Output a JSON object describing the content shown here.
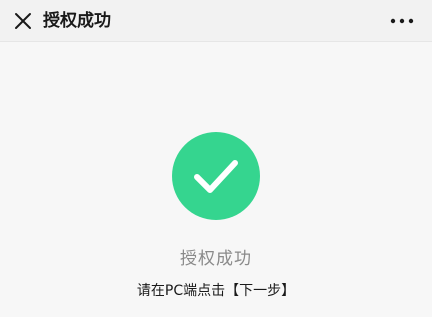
{
  "header": {
    "title": "授权成功",
    "close_icon": "close-icon",
    "more_icon": "more-horizontal-icon"
  },
  "content": {
    "status_icon": "checkmark-icon",
    "status_color": "#35d58f",
    "status_text": "授权成功",
    "hint_text": "请在PC端点击【下一步】"
  }
}
